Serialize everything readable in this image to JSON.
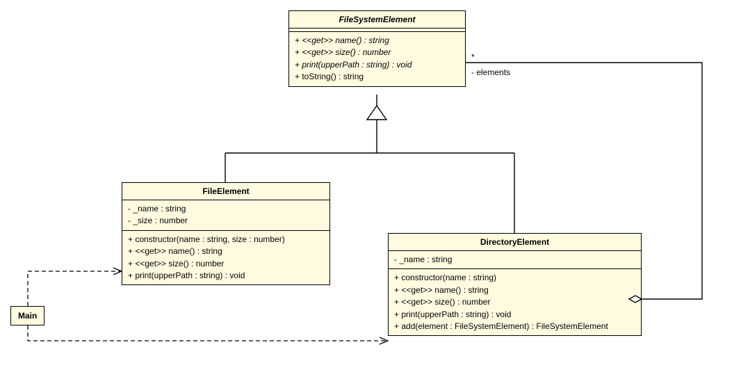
{
  "diagram_type": "UML Class Diagram",
  "classes": {
    "fsElement": {
      "name": "FileSystemElement",
      "abstract": true,
      "members": {
        "m1": "+ <<get>> name() : string",
        "m2": "+ <<get>> size() : number",
        "m3": "+ print(upperPath : string) : void",
        "m4": "+ toString() : string"
      }
    },
    "fileElement": {
      "name": "FileElement",
      "attributes": {
        "a1": "- _name : string",
        "a2": "- _size : number"
      },
      "methods": {
        "m1": "+ constructor(name : string, size : number)",
        "m2": "+ <<get>> name() : string",
        "m3": "+ <<get>> size() : number",
        "m4": "+ print(upperPath : string) : void"
      }
    },
    "directoryElement": {
      "name": "DirectoryElement",
      "attributes": {
        "a1": "- _name : string"
      },
      "methods": {
        "m1": "+ constructor(name : string)",
        "m2": "+ <<get>> name() : string",
        "m3": "+ <<get>> size() : number",
        "m4": "+ print(upperPath : string) : void",
        "m5": "+ add(element : FileSystemElement) : FileSystemElement"
      }
    },
    "main": {
      "name": "Main"
    }
  },
  "associations": {
    "elements": {
      "label": "- elements",
      "multiplicity": "*"
    }
  }
}
